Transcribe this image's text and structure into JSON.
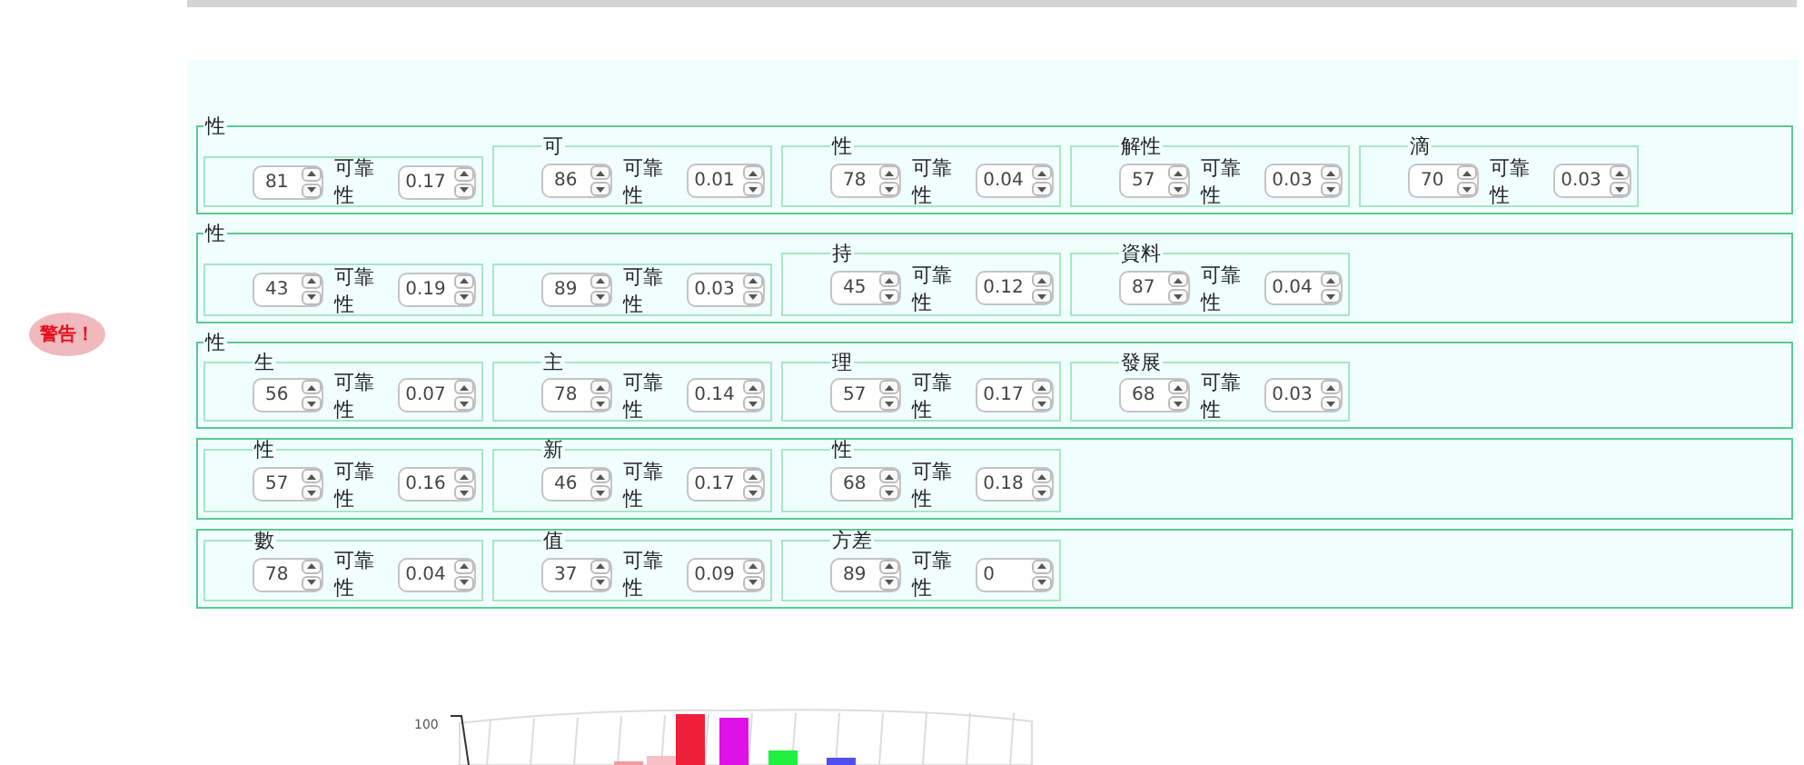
{
  "warning": {
    "label": "警告！"
  },
  "groups": [
    {
      "legend": "性",
      "items": [
        {
          "value": "81",
          "reliability_label": "可靠性",
          "reliability": "0.17"
        },
        {
          "legend": "可",
          "value": "86",
          "reliability_label": "可靠性",
          "reliability": "0.01"
        },
        {
          "legend": "性",
          "value": "78",
          "reliability_label": "可靠性",
          "reliability": "0.04"
        },
        {
          "legend": "解性",
          "value": "57",
          "reliability_label": "可靠性",
          "reliability": "0.03"
        },
        {
          "legend": "滴",
          "value": "70",
          "reliability_label": "可靠性",
          "reliability": "0.03"
        }
      ]
    },
    {
      "legend": "性",
      "items": [
        {
          "value": "43",
          "reliability_label": "可靠性",
          "reliability": "0.19"
        },
        {
          "value": "89",
          "reliability_label": "可靠性",
          "reliability": "0.03"
        },
        {
          "legend": "持",
          "value": "45",
          "reliability_label": "可靠性",
          "reliability": "0.12"
        },
        {
          "legend": "資料",
          "value": "87",
          "reliability_label": "可靠性",
          "reliability": "0.04"
        }
      ]
    },
    {
      "legend": "性",
      "items": [
        {
          "legend": "生",
          "value": "56",
          "reliability_label": "可靠性",
          "reliability": "0.07"
        },
        {
          "legend": "主",
          "value": "78",
          "reliability_label": "可靠性",
          "reliability": "0.14"
        },
        {
          "legend": "理",
          "value": "57",
          "reliability_label": "可靠性",
          "reliability": "0.17"
        },
        {
          "legend": "發展",
          "value": "68",
          "reliability_label": "可靠性",
          "reliability": "0.03"
        }
      ]
    },
    {
      "items": [
        {
          "legend": "性",
          "value": "57",
          "reliability_label": "可靠性",
          "reliability": "0.16"
        },
        {
          "legend": "新",
          "value": "46",
          "reliability_label": "可靠性",
          "reliability": "0.17"
        },
        {
          "legend": "性",
          "value": "68",
          "reliability_label": "可靠性",
          "reliability": "0.18"
        }
      ]
    },
    {
      "items": [
        {
          "legend": "數",
          "value": "78",
          "reliability_label": "可靠性",
          "reliability": "0.04"
        },
        {
          "legend": "值",
          "value": "37",
          "reliability_label": "可靠性",
          "reliability": "0.09"
        },
        {
          "legend": "方差",
          "value": "89",
          "reliability_label": "可靠性",
          "reliability": "0"
        }
      ]
    }
  ],
  "chart": {
    "axis_label": "100"
  }
}
